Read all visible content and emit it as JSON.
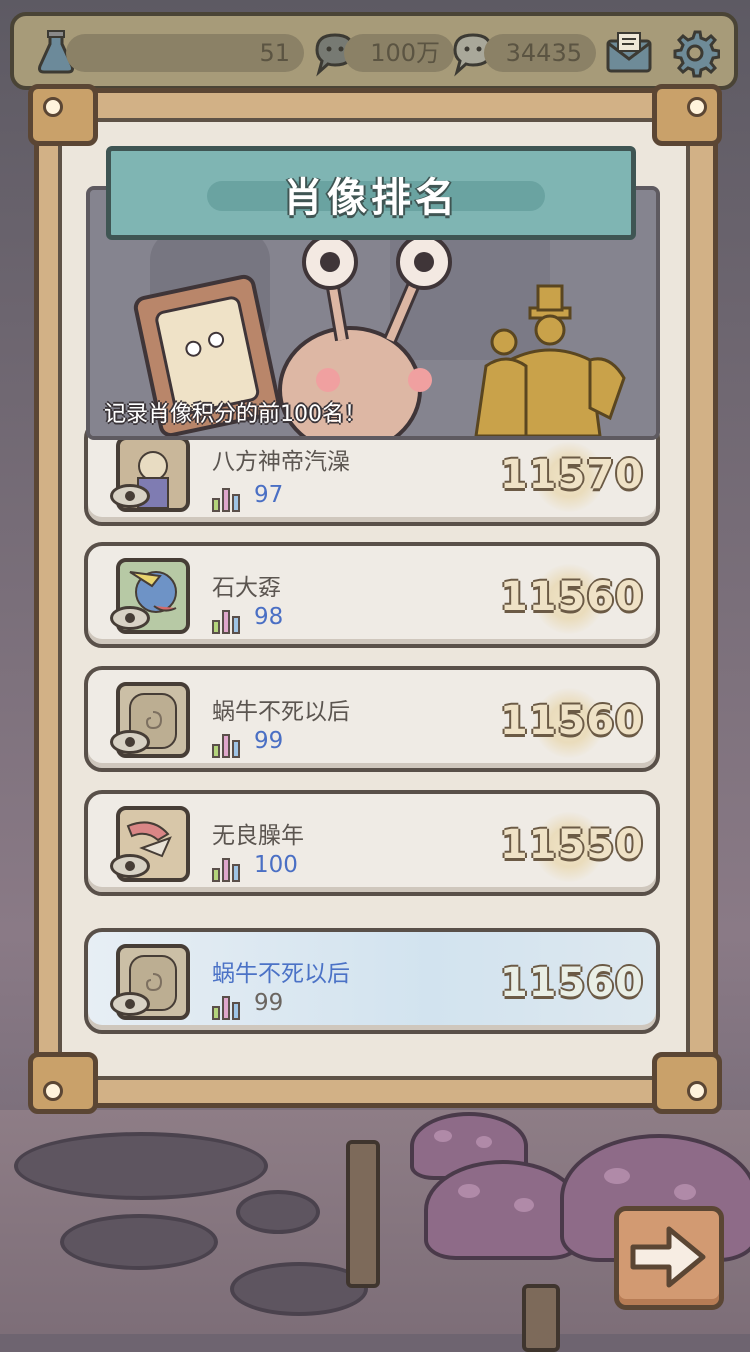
{
  "topbar": {
    "resource1_value": "51",
    "resource2_value": "100万",
    "resource3_value": "34435",
    "icons": [
      "flask-icon",
      "chat-bubble-icon",
      "chat-bubble-icon",
      "mail-icon",
      "gear-icon"
    ]
  },
  "panel": {
    "title": "肖像排名",
    "subtitle": "记录肖像积分的前100名！"
  },
  "rows": [
    {
      "name": "八方神帝汽澡",
      "rank": "97",
      "score": "11570"
    },
    {
      "name": "石大孬",
      "rank": "98",
      "score": "11560"
    },
    {
      "name": "蜗牛不死以后",
      "rank": "99",
      "score": "11560"
    },
    {
      "name": "无良臊年",
      "rank": "100",
      "score": "11550"
    }
  ],
  "my_row": {
    "name": "蜗牛不死以后",
    "rank": "99",
    "score": "11560"
  },
  "colors": {
    "frame": "#d2b186",
    "title_plate": "#7fb5b3",
    "rank_blue": "#4a6fc4",
    "score_outline": "#6b5a45"
  },
  "buttons": {
    "next_icon": "arrow-right-icon"
  }
}
